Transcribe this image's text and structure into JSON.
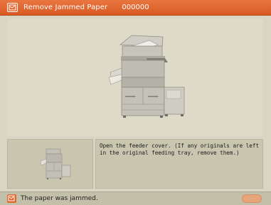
{
  "header": {
    "title": "Remove Jammed Paper",
    "code": "000000",
    "icon": "jammed-paper-icon"
  },
  "instruction": {
    "text": "Open the feeder cover. (If any originals are left in the original feeding tray, remove them.)"
  },
  "status": {
    "message": "The paper was jammed.",
    "icon": "jam-alert-icon"
  },
  "colors": {
    "accent": "#e06a32",
    "background": "#d8d6c2",
    "panel": "#c9c6b0"
  }
}
